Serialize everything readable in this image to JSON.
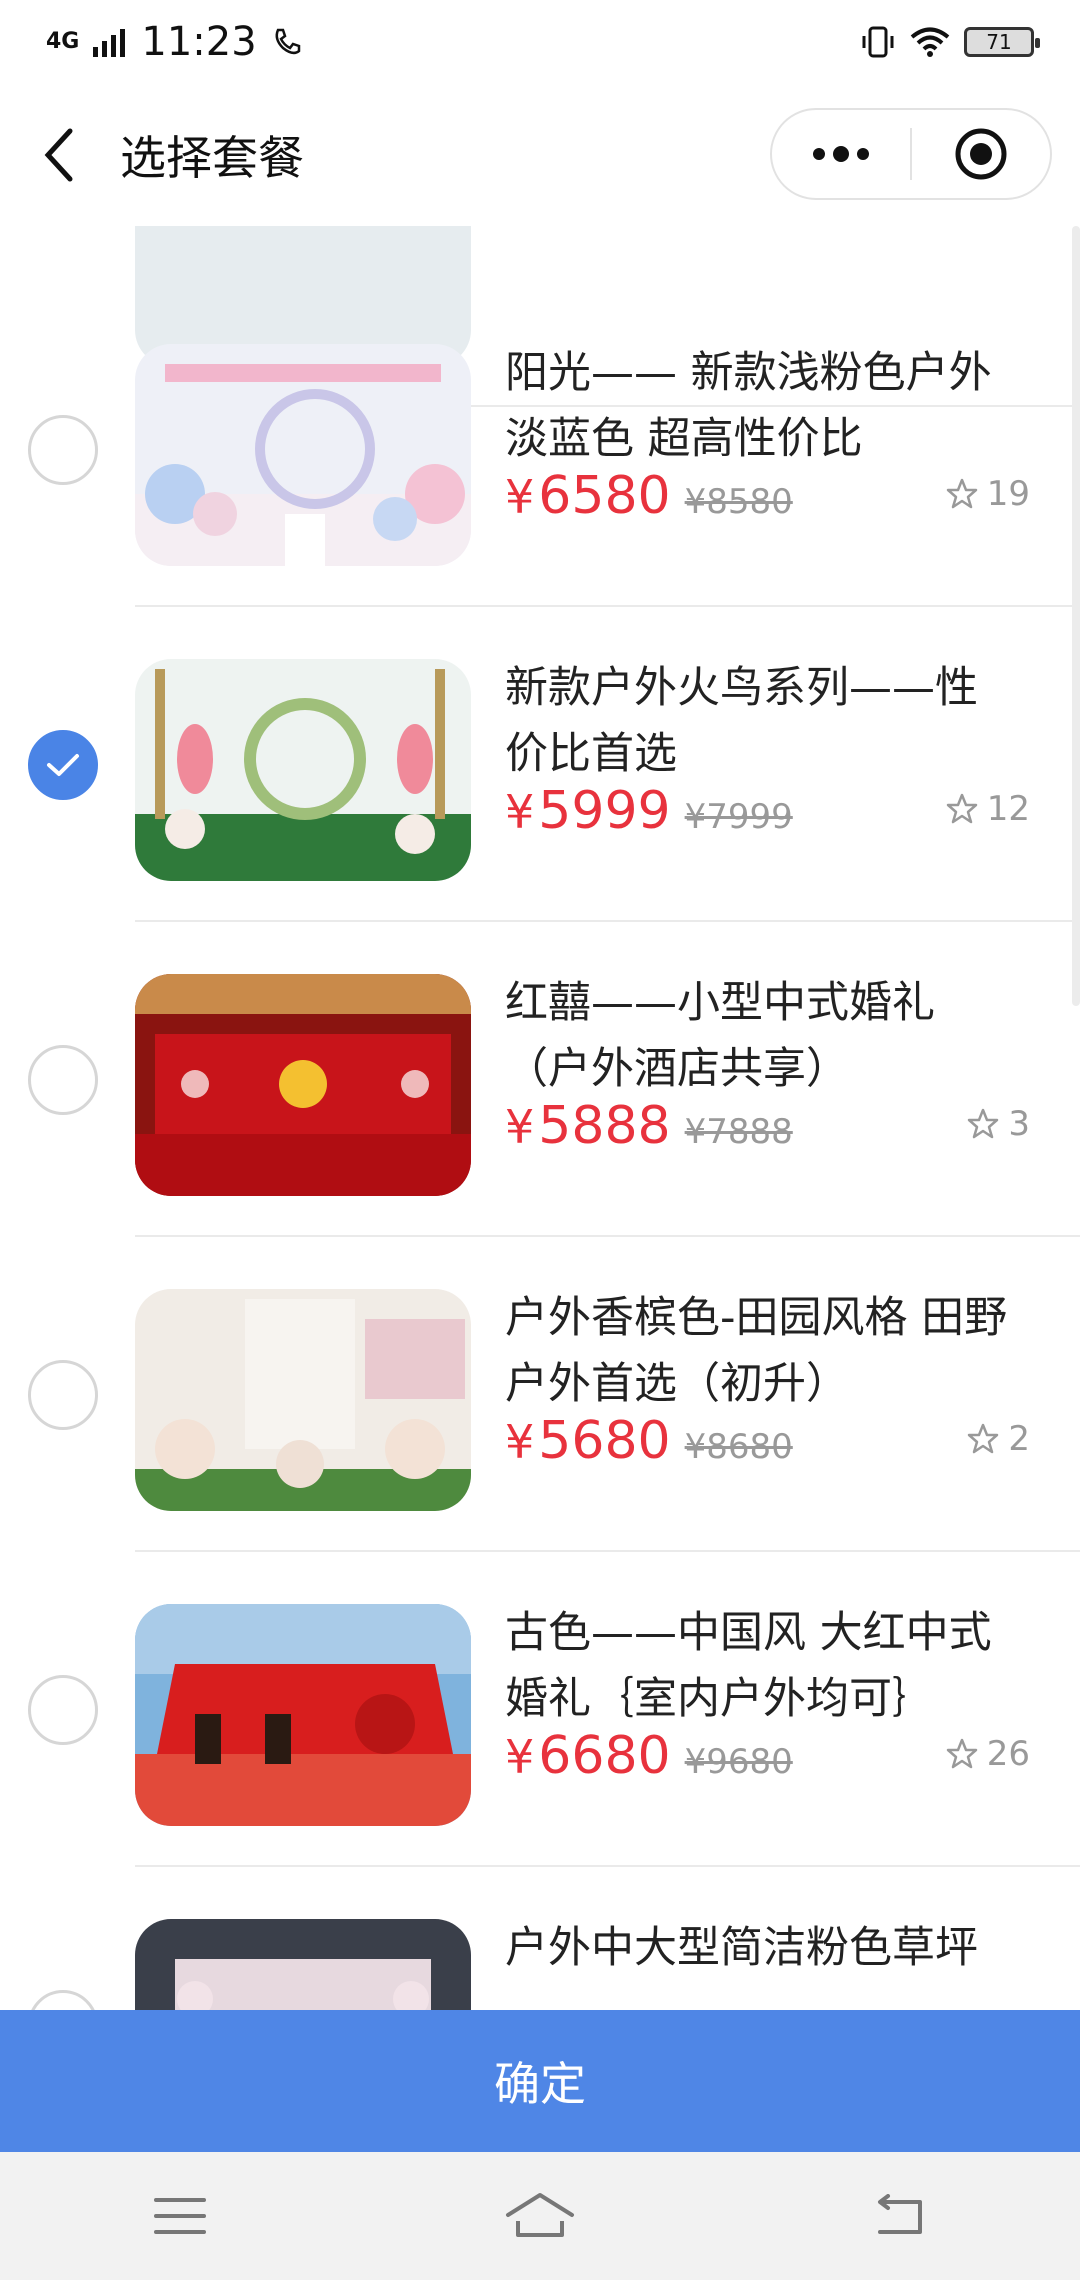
{
  "status": {
    "time": "11:23",
    "network": "4G",
    "battery": "71"
  },
  "header": {
    "title": "选择套餐",
    "back_icon": "chevron-left-icon",
    "more_icon": "more-dots-icon",
    "close_icon": "target-close-icon"
  },
  "items": [
    {
      "title_line1": "阳光—— 新款浅粉色户外",
      "title_line2": "淡蓝色 超高性价比",
      "currency": "¥",
      "price": "6580",
      "original": "¥8580",
      "likes": "19",
      "selected": false,
      "theme_color": "#f3c9d9"
    },
    {
      "title_line1": "新款户外火鸟系列——性",
      "title_line2": "价比首选",
      "currency": "¥",
      "price": "5999",
      "original": "¥7999",
      "likes": "12",
      "selected": true,
      "theme_color": "#2f7a3a"
    },
    {
      "title_line1": "红囍——小型中式婚礼",
      "title_line2": "（户外酒店共享）",
      "currency": "¥",
      "price": "5888",
      "original": "¥7888",
      "likes": "3",
      "selected": false,
      "theme_color": "#c8141a"
    },
    {
      "title_line1": "户外香槟色-田园风格 田野",
      "title_line2": "户外首选（初升）",
      "currency": "¥",
      "price": "5680",
      "original": "¥8680",
      "likes": "2",
      "selected": false,
      "theme_color": "#e9dcd0"
    },
    {
      "title_line1": "古色——中国风 大红中式",
      "title_line2": "婚礼｛室内户外均可｝",
      "currency": "¥",
      "price": "6680",
      "original": "¥9680",
      "likes": "26",
      "selected": false,
      "theme_color": "#d81e1e"
    },
    {
      "title_line1": "户外中大型简洁粉色草坪",
      "title_line2": "",
      "currency": "¥",
      "price": "",
      "original": "",
      "likes": "",
      "selected": false,
      "theme_color": "#d9a8b5"
    }
  ],
  "confirm_label": "确定",
  "nav": {
    "menu_icon": "menu-icon",
    "home_icon": "home-icon",
    "back_icon": "back-arrow-icon"
  }
}
